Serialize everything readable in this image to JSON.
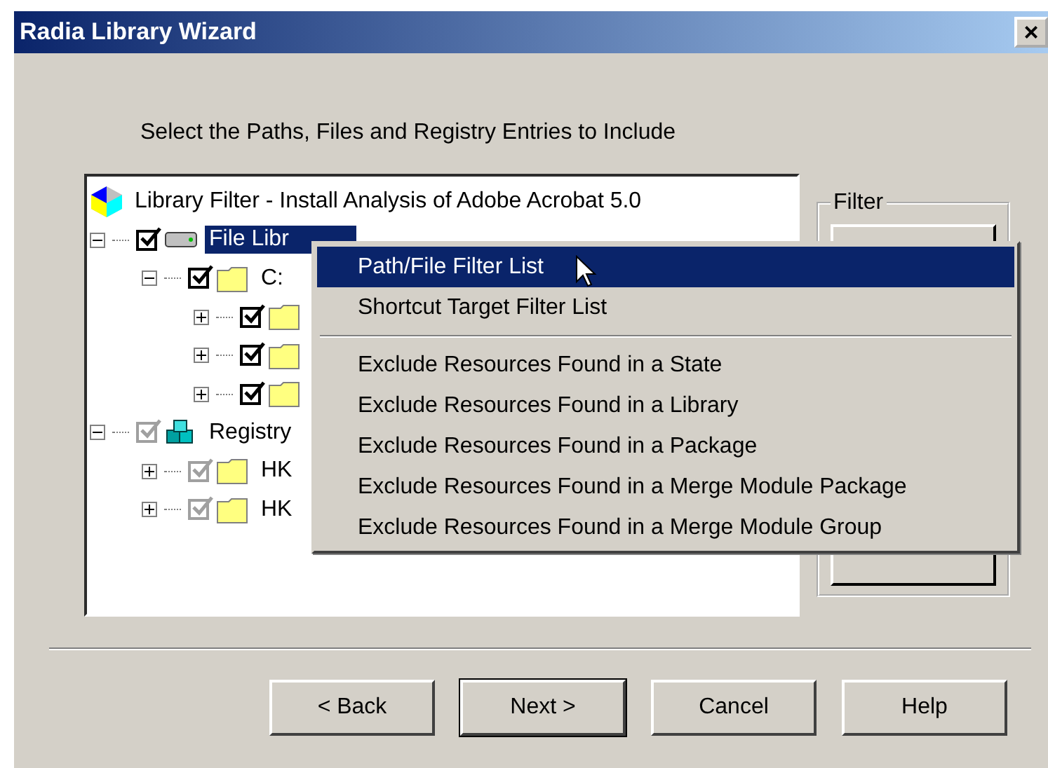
{
  "window": {
    "title": "Radia Library Wizard",
    "close": "×"
  },
  "instruction": "Select the Paths, Files and Registry Entries to Include",
  "tree": {
    "label": "Library Filter - Install Analysis of Adobe Acrobat 5.0",
    "kind": "filter",
    "children": [
      {
        "label": "File Libr",
        "kind": "drive",
        "expanded": true,
        "checked": true,
        "grayed": false,
        "selected": true,
        "children": [
          {
            "label": "C:",
            "kind": "folder",
            "expanded": true,
            "checked": true,
            "grayed": false,
            "selected": false,
            "children": [
              {
                "kind": "folder",
                "expanded": false,
                "checked": true,
                "grayed": false
              },
              {
                "kind": "folder",
                "expanded": false,
                "checked": true,
                "grayed": false
              },
              {
                "kind": "folder",
                "expanded": false,
                "checked": true,
                "grayed": false
              }
            ]
          }
        ]
      },
      {
        "label": "Registry",
        "kind": "registry",
        "expanded": true,
        "checked": true,
        "grayed": true,
        "selected": false,
        "children": [
          {
            "label": "HK",
            "kind": "folder",
            "expanded": false,
            "checked": true,
            "grayed": true,
            "selected": false
          },
          {
            "label": "HK",
            "kind": "folder",
            "expanded": false,
            "checked": true,
            "grayed": true,
            "selected": false
          }
        ]
      }
    ]
  },
  "filter_group": {
    "legend": "Filter"
  },
  "menu_groups": [
    {
      "items": [
        {
          "label": "Path/File Filter List",
          "selected": true
        },
        {
          "label": "Shortcut Target Filter List",
          "selected": false
        }
      ]
    },
    {
      "items": [
        {
          "label": "Exclude Resources Found in a State",
          "selected": false
        },
        {
          "label": "Exclude Resources Found in a Library",
          "selected": false
        },
        {
          "label": "Exclude Resources Found in a Package",
          "selected": false
        },
        {
          "label": "Exclude Resources Found in a Merge Module Package",
          "selected": false
        },
        {
          "label": "Exclude Resources Found in a Merge Module Group",
          "selected": false
        }
      ]
    }
  ],
  "buttons": [
    {
      "label": "< Back",
      "default": false
    },
    {
      "label": "Next >",
      "default": true
    },
    {
      "label": "Cancel",
      "default": false
    },
    {
      "label": "Help",
      "default": false
    }
  ]
}
